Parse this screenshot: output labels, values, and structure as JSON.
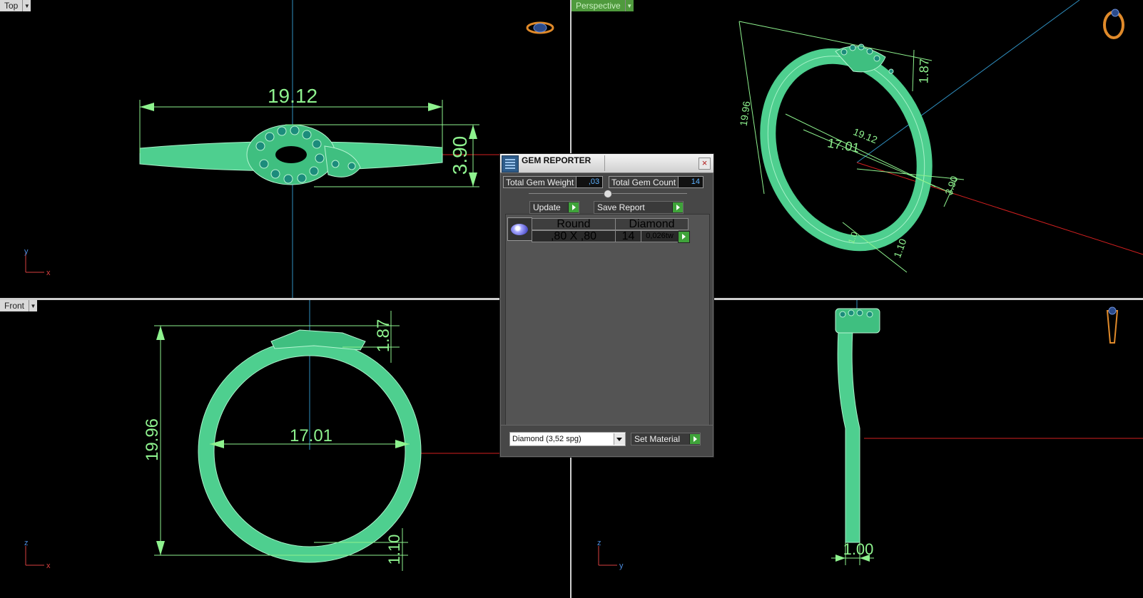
{
  "viewports": {
    "top": {
      "label": "Top",
      "axis_y": "y",
      "axis_x": "x",
      "dims": {
        "width": "19.12",
        "height": "3.90"
      }
    },
    "perspective": {
      "label": "Perspective",
      "dims": {
        "outer": "19.96",
        "width": "19.12",
        "inner": "17.01",
        "head": "1.87",
        "height": "3.90",
        "shank": "1.10",
        "bottom": "1.0"
      }
    },
    "front": {
      "label": "Front",
      "axis_y": "z",
      "axis_x": "x",
      "dims": {
        "outer": "19.96",
        "inner": "17.01",
        "head": "1.87",
        "shank": "1.10"
      }
    },
    "right": {
      "axis_y": "z",
      "axis_x": "y",
      "dims": {
        "width": "1.00"
      }
    }
  },
  "gem_reporter": {
    "title": "GEM REPORTER",
    "close": "×",
    "total_weight_label": "Total Gem Weight",
    "total_weight_value": ",03",
    "total_count_label": "Total Gem Count",
    "total_count_value": "14",
    "update_label": "Update",
    "save_label": "Save Report",
    "gems": [
      {
        "shape": "Round",
        "material": "Diamond",
        "size": ",80 X ,80",
        "count": "14",
        "weight": "0,026tw"
      }
    ],
    "material_select": "Diamond      (3,52 spg)",
    "set_material_label": "Set Material"
  },
  "colors": {
    "model": "#5ed49a",
    "dimension": "#8ef28e",
    "axis_red": "#d42020",
    "axis_blue": "#2f8fc0",
    "accent": "#3fa33a"
  }
}
